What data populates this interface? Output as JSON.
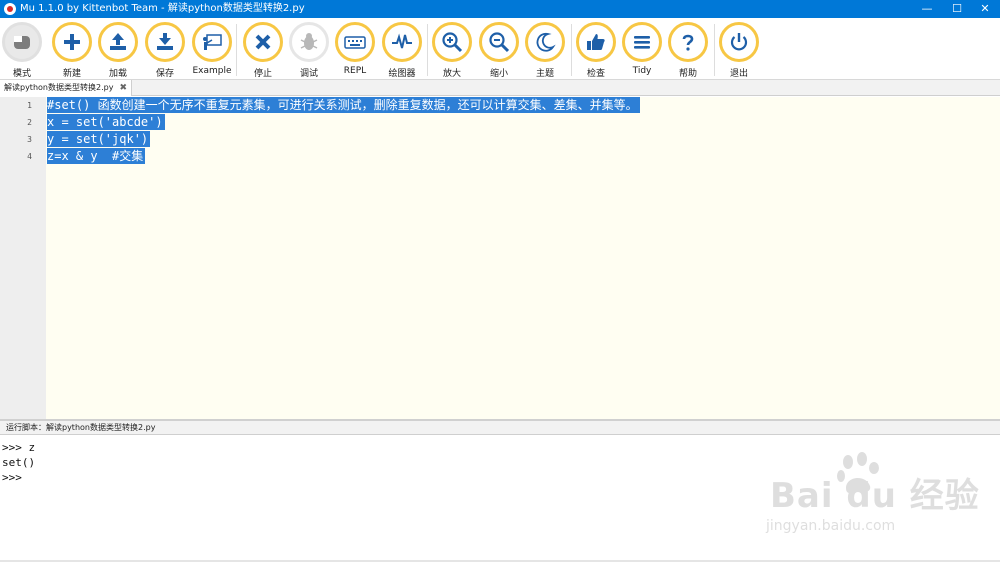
{
  "window": {
    "title": "Mu 1.1.0 by Kittenbot Team - 解读python数据类型转换2.py",
    "controls": {
      "minimize": "—",
      "maximize": "☐",
      "close": "✕"
    }
  },
  "toolbar": {
    "buttons": [
      {
        "id": "mode",
        "label": "模式",
        "icon": "mode-icon"
      },
      {
        "id": "new",
        "label": "新建",
        "icon": "plus-icon"
      },
      {
        "id": "load",
        "label": "加载",
        "icon": "upload-icon"
      },
      {
        "id": "save",
        "label": "保存",
        "icon": "download-icon"
      },
      {
        "id": "example",
        "label": "Example",
        "icon": "presentation-icon"
      },
      {
        "id": "stop",
        "label": "停止",
        "icon": "close-icon"
      },
      {
        "id": "debug",
        "label": "调试",
        "icon": "bug-icon"
      },
      {
        "id": "repl",
        "label": "REPL",
        "icon": "keyboard-icon"
      },
      {
        "id": "plotter",
        "label": "绘图器",
        "icon": "pulse-icon"
      },
      {
        "id": "zoom-in",
        "label": "放大",
        "icon": "zoom-in-icon"
      },
      {
        "id": "zoom-out",
        "label": "缩小",
        "icon": "zoom-out-icon"
      },
      {
        "id": "theme",
        "label": "主题",
        "icon": "moon-icon"
      },
      {
        "id": "check",
        "label": "检查",
        "icon": "thumbs-up-icon"
      },
      {
        "id": "tidy",
        "label": "Tidy",
        "icon": "lines-icon"
      },
      {
        "id": "help",
        "label": "帮助",
        "icon": "question-icon"
      },
      {
        "id": "quit",
        "label": "退出",
        "icon": "power-icon"
      }
    ]
  },
  "colors": {
    "button_ring": "#f7c744",
    "button_icon": "#1e5fa8",
    "selection": "#2d7fd6",
    "editor_bg": "#fffef2",
    "titlebar": "#0078d7"
  },
  "tabs": [
    {
      "label": "解读python数据类型转换2.py",
      "close": "✖"
    }
  ],
  "editor": {
    "lines": [
      {
        "number": "1",
        "text": "#set() 函数创建一个无序不重复元素集，可进行关系测试，删除重复数据，还可以计算交集、差集、并集等。"
      },
      {
        "number": "2",
        "text": "x = set('abcde')"
      },
      {
        "number": "3",
        "text": "y = set('jqk')"
      },
      {
        "number": "4",
        "text": "z=x & y  #交集"
      }
    ]
  },
  "repl": {
    "title": "运行脚本：解读python数据类型转换2.py",
    "lines": [
      ">>> z",
      "set()",
      ">>> "
    ]
  },
  "watermark": {
    "brand": "Bai du 经验",
    "url": "jingyan.baidu.com"
  }
}
